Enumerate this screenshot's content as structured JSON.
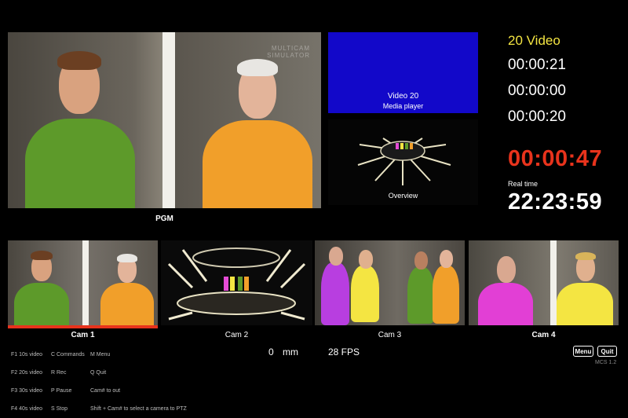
{
  "program": {
    "label": "PGM",
    "watermark_line1": "MULTICAM",
    "watermark_line2": "SIMULATOR"
  },
  "media_player": {
    "title": "Video 20",
    "subtitle": "Media player",
    "color": "#1208c9"
  },
  "overview": {
    "label": "Overview"
  },
  "info": {
    "video_title": "20 Video",
    "time1": "00:00:21",
    "time2": "00:00:00",
    "time3": "00:00:20",
    "countdown": "00:00:47",
    "realtime_label": "Real time",
    "realtime": "22:23:59",
    "countdown_color": "#e8331c",
    "title_color": "#f4e542"
  },
  "cams": [
    {
      "label": "Cam 1",
      "bold": true,
      "live": true
    },
    {
      "label": "Cam 2",
      "bold": false,
      "live": false
    },
    {
      "label": "Cam 3",
      "bold": false,
      "live": false
    },
    {
      "label": "Cam 4",
      "bold": true,
      "live": false
    }
  ],
  "help": {
    "col1": [
      "F1 10s video",
      "F2 20s video",
      "F3 30s video",
      "F4 40s video"
    ],
    "col2": [
      "C Commands",
      "R Rec",
      "P Pause",
      "S Stop"
    ],
    "col3": [
      "M Menu",
      "Q Quit",
      "Cam# to out",
      "Shift + Cam# to select a camera to PTZ"
    ]
  },
  "status": {
    "focal_value": "0",
    "focal_unit": "mm",
    "fps": "28 FPS"
  },
  "buttons": {
    "menu": "Menu",
    "quit": "Quit"
  },
  "version": "MCS 1.2"
}
